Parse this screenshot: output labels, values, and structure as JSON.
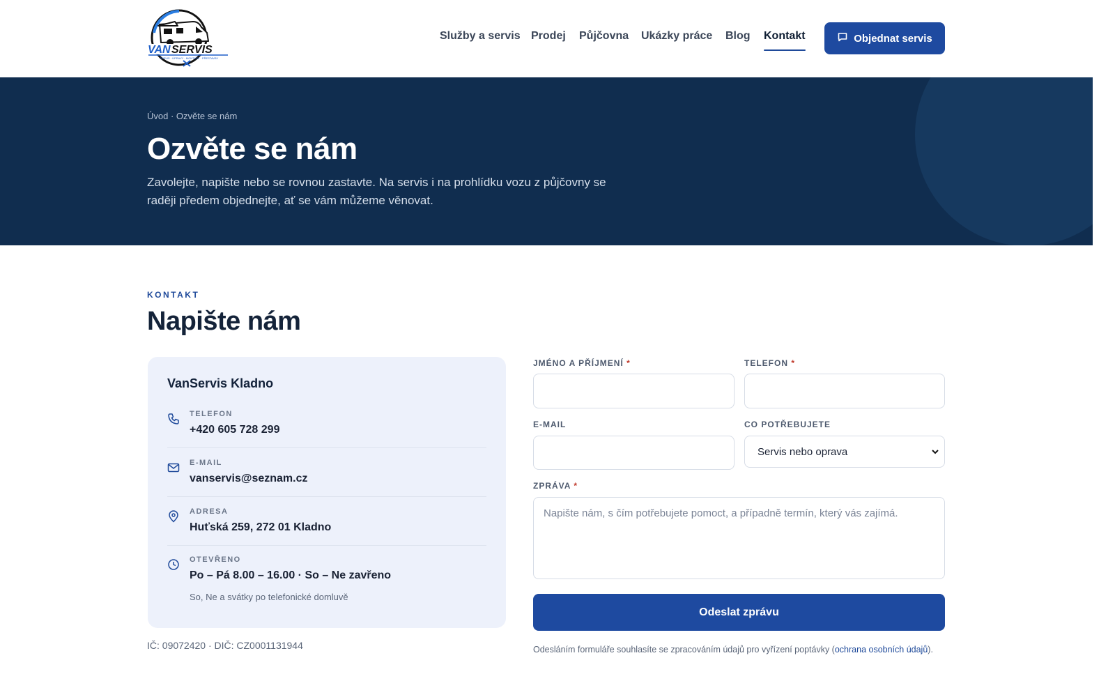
{
  "header": {
    "logo_text": "VANSERVIS",
    "nav": [
      {
        "label": "Služby a servis",
        "active": false
      },
      {
        "label": "Prodej",
        "active": false
      },
      {
        "label": "Půjčovna",
        "active": false
      },
      {
        "label": "Ukázky práce",
        "active": false
      },
      {
        "label": "Blog",
        "active": false
      },
      {
        "label": "Kontakt",
        "active": true
      }
    ],
    "cta_label": "Objednat servis",
    "cta_icon": "chat-icon"
  },
  "hero": {
    "breadcrumb": "Úvod · Ozvěte se nám",
    "title": "Ozvěte se nám",
    "lead": "Zavolejte, napište nebo se rovnou zastavte. Na servis i na prohlídku vozu z půjčovny se raději předem objednejte, ať se vám můžeme věnovat."
  },
  "section": {
    "eyebrow": "KONTAKT",
    "title": "Napište nám"
  },
  "card": {
    "title": "VanServis Kladno",
    "items": [
      {
        "icon": "phone-icon",
        "label": "TELEFON",
        "value": "+420 605 728 299"
      },
      {
        "icon": "mail-icon",
        "label": "E-MAIL",
        "value": "vanservis@seznam.cz"
      },
      {
        "icon": "map-pin-icon",
        "label": "ADRESA",
        "value": "Huťská 259, 272 01 Kladno"
      },
      {
        "icon": "clock-icon",
        "label": "OTEVŘENO",
        "value": "Po – Pá 8.00 – 16.00 · So – Ne zavřeno",
        "sub": "So, Ne a svátky po telefonické domluvě"
      }
    ]
  },
  "company": "IČ: 09072420 · DIČ: CZ0001131944",
  "form": {
    "name_label": "JMÉNO A PŘÍJMENÍ",
    "phone_label": "TELEFON",
    "email_label": "E-MAIL",
    "need_label": "CO POTŘEBUJETE",
    "need_value": "Servis nebo oprava",
    "message_label": "ZPRÁVA",
    "message_placeholder": "Napište nám, s čím potřebujete pomoct, a případně termín, který vás zajímá.",
    "required_mark": "*",
    "submit_label": "Odeslat zprávu",
    "consent_text": "Odesláním formuláře souhlasíte se zpracováním údajů pro vyřízení poptávky (",
    "consent_link": "ochrana osobních údajů",
    "consent_end": ")."
  },
  "colors": {
    "primary": "#1e4aa0",
    "hero_bg": "#102d4f",
    "card_bg": "#edf1fb"
  }
}
